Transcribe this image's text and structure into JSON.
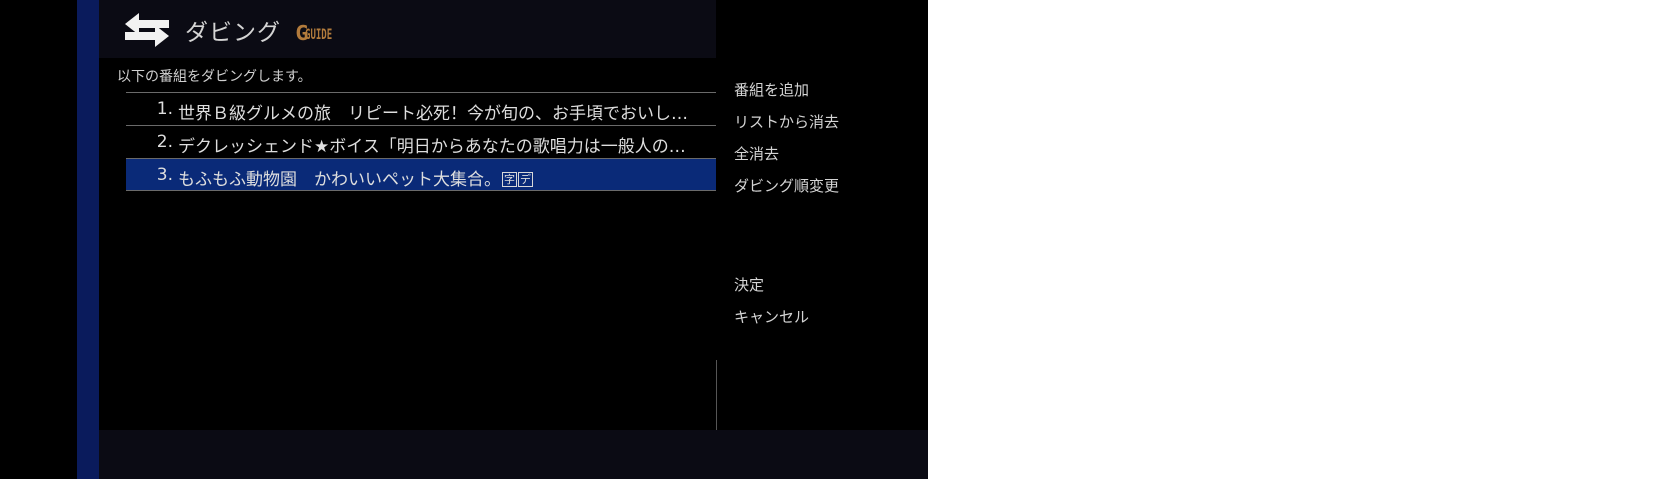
{
  "header": {
    "title": "ダビング",
    "logo_letter": "G",
    "logo_word": "GUIDE"
  },
  "instruction": "以下の番組をダビングします。",
  "programs": [
    {
      "number": "1.",
      "title": "世界Ｂ級グルメの旅　リピート必死！今が旬の、お手頃でおいし…",
      "badges": []
    },
    {
      "number": "2.",
      "title": "デクレッシェンド★ボイス「明日からあなたの歌唱力は一般人の…",
      "badges": []
    },
    {
      "number": "3.",
      "title": "もふもふ動物園　かわいいペット大集合。",
      "badges": [
        "字",
        "デ"
      ],
      "selected": true
    }
  ],
  "side_menu": [
    {
      "label": "番組を追加"
    },
    {
      "label": "リストから消去"
    },
    {
      "label": "全消去"
    },
    {
      "label": "ダビング順変更"
    }
  ],
  "actions": {
    "confirm": "決定",
    "cancel": "キャンセル"
  },
  "colors": {
    "selected_row": "#0a2a78",
    "left_strip": "#0a1b5c",
    "logo": "#b27b3c"
  }
}
